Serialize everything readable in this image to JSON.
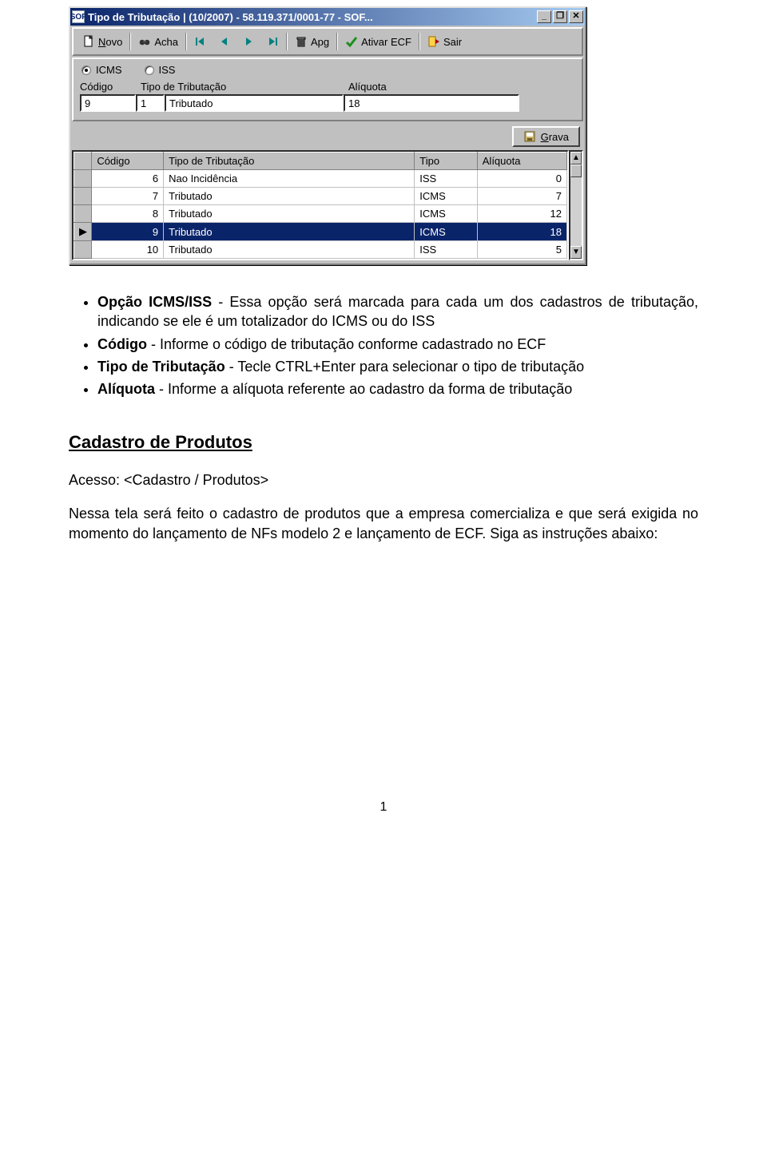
{
  "window": {
    "app_icon_text": "SOF",
    "title": "Tipo de Tributação | (10/2007) - 58.119.371/0001-77 - SOF...",
    "min": "_",
    "restore": "❐",
    "close": "✕"
  },
  "toolbar": {
    "novo": "Novo",
    "acha": "Acha",
    "apg": "Apg",
    "ativar": "Ativar ECF",
    "sair": "Sair"
  },
  "radios": {
    "icms": "ICMS",
    "iss": "ISS"
  },
  "form": {
    "lbl_codigo": "Código",
    "lbl_tipo": "Tipo de Tributação",
    "lbl_aliq": "Alíquota",
    "val_codigo": "9",
    "val_tipo_cod": "1",
    "val_tipo_desc": "Tributado",
    "val_aliq": "18"
  },
  "grava": {
    "label": "Grava"
  },
  "grid": {
    "h_codigo": "Código",
    "h_tipo": "Tipo de Tributação",
    "h_t": "Tipo",
    "h_aliq": "Alíquota",
    "rows": [
      {
        "codigo": "6",
        "tipo": "Nao Incidência",
        "t": "ISS",
        "aliq": "0",
        "sel": false
      },
      {
        "codigo": "7",
        "tipo": "Tributado",
        "t": "ICMS",
        "aliq": "7",
        "sel": false
      },
      {
        "codigo": "8",
        "tipo": "Tributado",
        "t": "ICMS",
        "aliq": "12",
        "sel": false
      },
      {
        "codigo": "9",
        "tipo": "Tributado",
        "t": "ICMS",
        "aliq": "18",
        "sel": true
      },
      {
        "codigo": "10",
        "tipo": "Tributado",
        "t": "ISS",
        "aliq": "5",
        "sel": false
      }
    ]
  },
  "doc": {
    "b1_head": "Opção ICMS/ISS",
    "b1_tail": " - Essa opção será marcada para cada um dos cadastros de tributação, indicando se ele é um totalizador do ICMS ou do ISS",
    "b2_head": "Código",
    "b2_tail": " - Informe o código de tributação conforme cadastrado no ECF",
    "b3_head": "Tipo de Tributação",
    "b3_tail": " - Tecle CTRL+Enter para selecionar o tipo de tributação",
    "b4_head": "Alíquota",
    "b4_tail": " - Informe a alíquota referente ao cadastro da forma de tributação",
    "h2": "Cadastro de Produtos",
    "p1": "Acesso: <Cadastro / Produtos>",
    "p2": "Nessa tela será feito o cadastro de produtos que a empresa comercializa e que será exigida no momento do lançamento de NFs modelo 2 e lançamento de ECF. Siga as instruções abaixo:",
    "page": "1"
  }
}
